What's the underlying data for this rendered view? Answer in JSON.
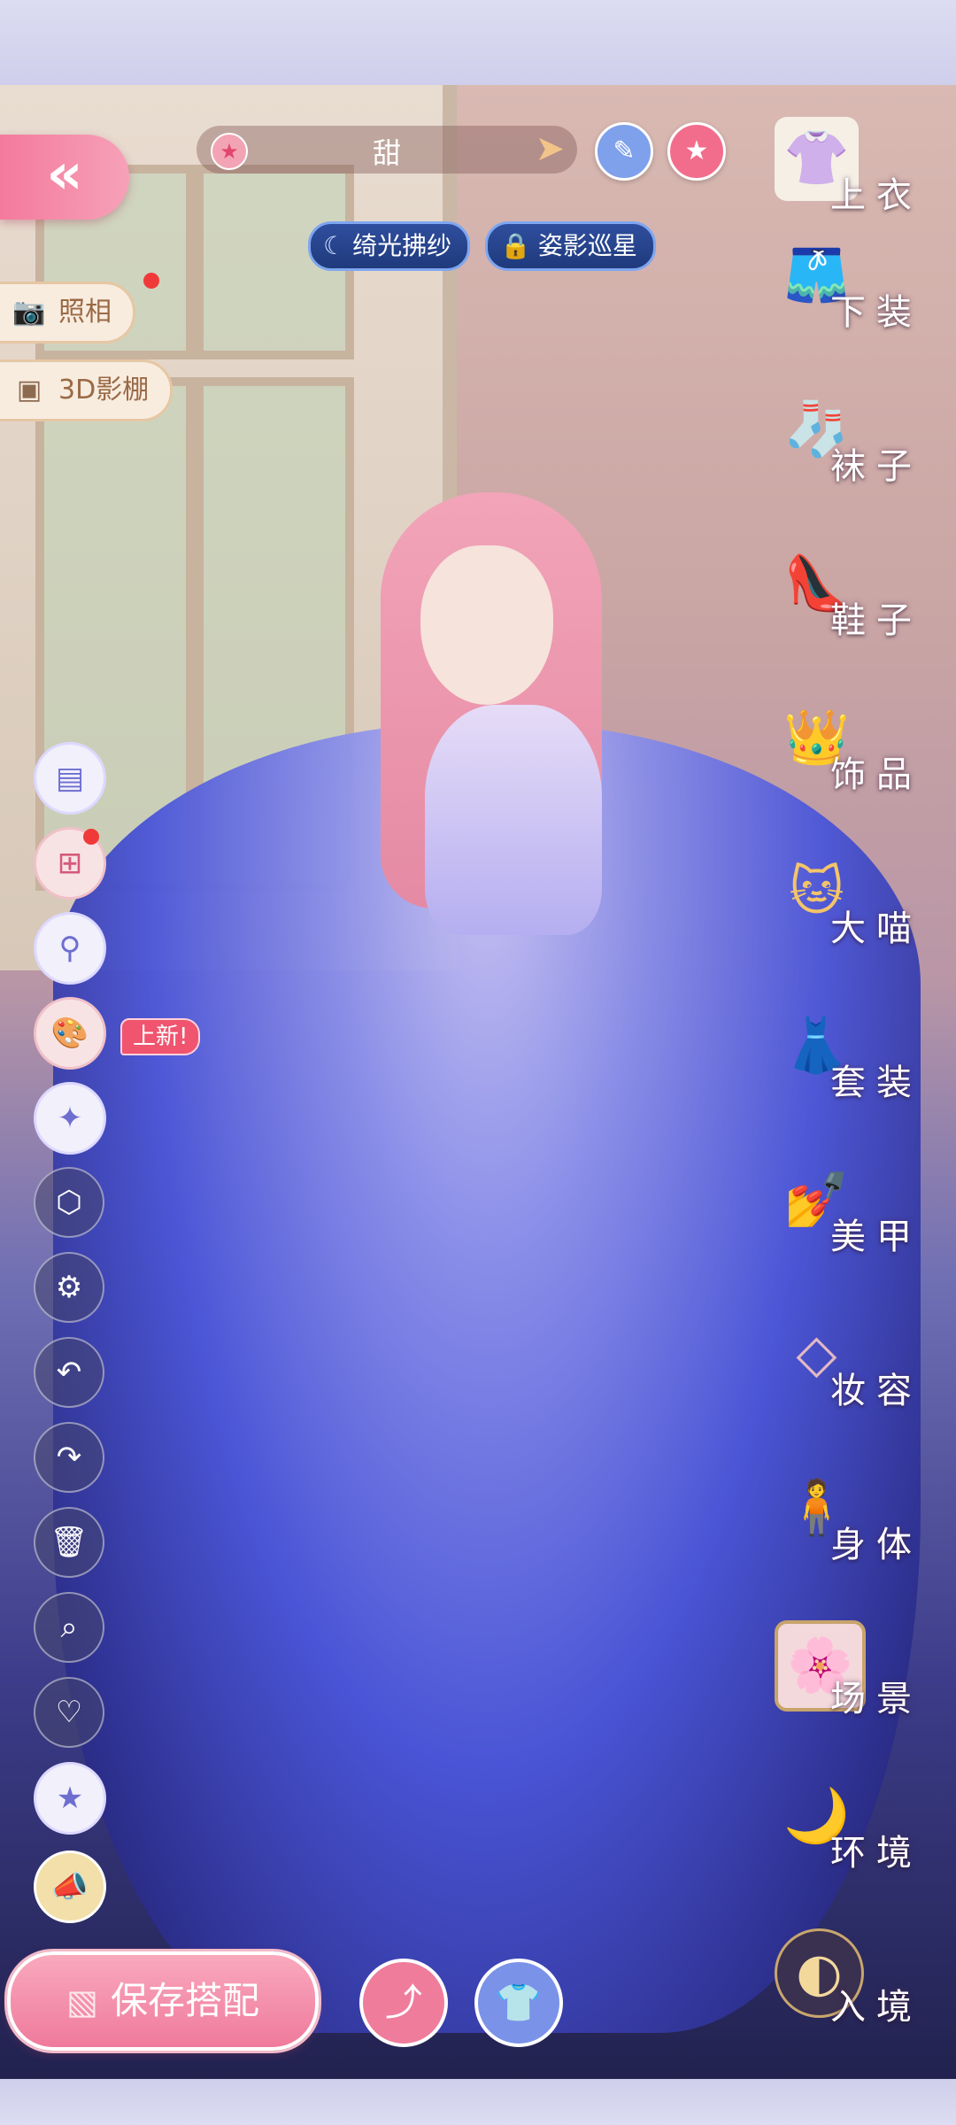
{
  "top_bar": {
    "back_icon": "double-chevron-left-icon",
    "mood_label": "甜",
    "edit_icon": "pencil-icon",
    "favorite_icon": "star-icon"
  },
  "tags": [
    {
      "icon": "moon-icon",
      "label": "绮光拂纱"
    },
    {
      "icon": "lock-icon",
      "label": "姿影巡星"
    }
  ],
  "side_buttons": [
    {
      "icon": "camera-icon",
      "label": "照相"
    },
    {
      "icon": "cube-icon",
      "label": "3D影棚"
    }
  ],
  "left_tools": {
    "new_badge": "上新!",
    "items": [
      "outfit-card-icon",
      "layer-add-icon",
      "magnify-person-icon",
      "palette-icon",
      "star-wand-icon",
      "frame-icon",
      "gear-icon",
      "undo-icon",
      "redo-icon",
      "trash-icon",
      "search-icon",
      "heart-icon",
      "star-badge-icon",
      "megaphone-icon"
    ]
  },
  "categories": [
    {
      "label": "上衣",
      "icon": "top-icon"
    },
    {
      "label": "下装",
      "icon": "shorts-icon"
    },
    {
      "label": "袜子",
      "icon": "sock-icon"
    },
    {
      "label": "鞋子",
      "icon": "shoe-icon"
    },
    {
      "label": "饰品",
      "icon": "tiara-icon"
    },
    {
      "label": "大喵",
      "icon": "cat-icon"
    },
    {
      "label": "套装",
      "icon": "outfit-icon"
    },
    {
      "label": "美甲",
      "icon": "nail-polish-icon"
    },
    {
      "label": "妆容",
      "icon": "makeup-icon"
    },
    {
      "label": "身体",
      "icon": "body-icon"
    },
    {
      "label": "场景",
      "icon": "scene-icon"
    },
    {
      "label": "环境",
      "icon": "moon-leaf-icon"
    },
    {
      "label": "入境",
      "icon": "portal-icon"
    }
  ],
  "bottom": {
    "save_label": "保存搭配",
    "save_icon": "card-icon",
    "share_icon": "share-icon",
    "outfit_icon": "dress-icon"
  },
  "colors": {
    "accent_pink": "#f47a9d",
    "accent_blue": "#7a93e8",
    "tag_blue": "#1f3a7c"
  }
}
